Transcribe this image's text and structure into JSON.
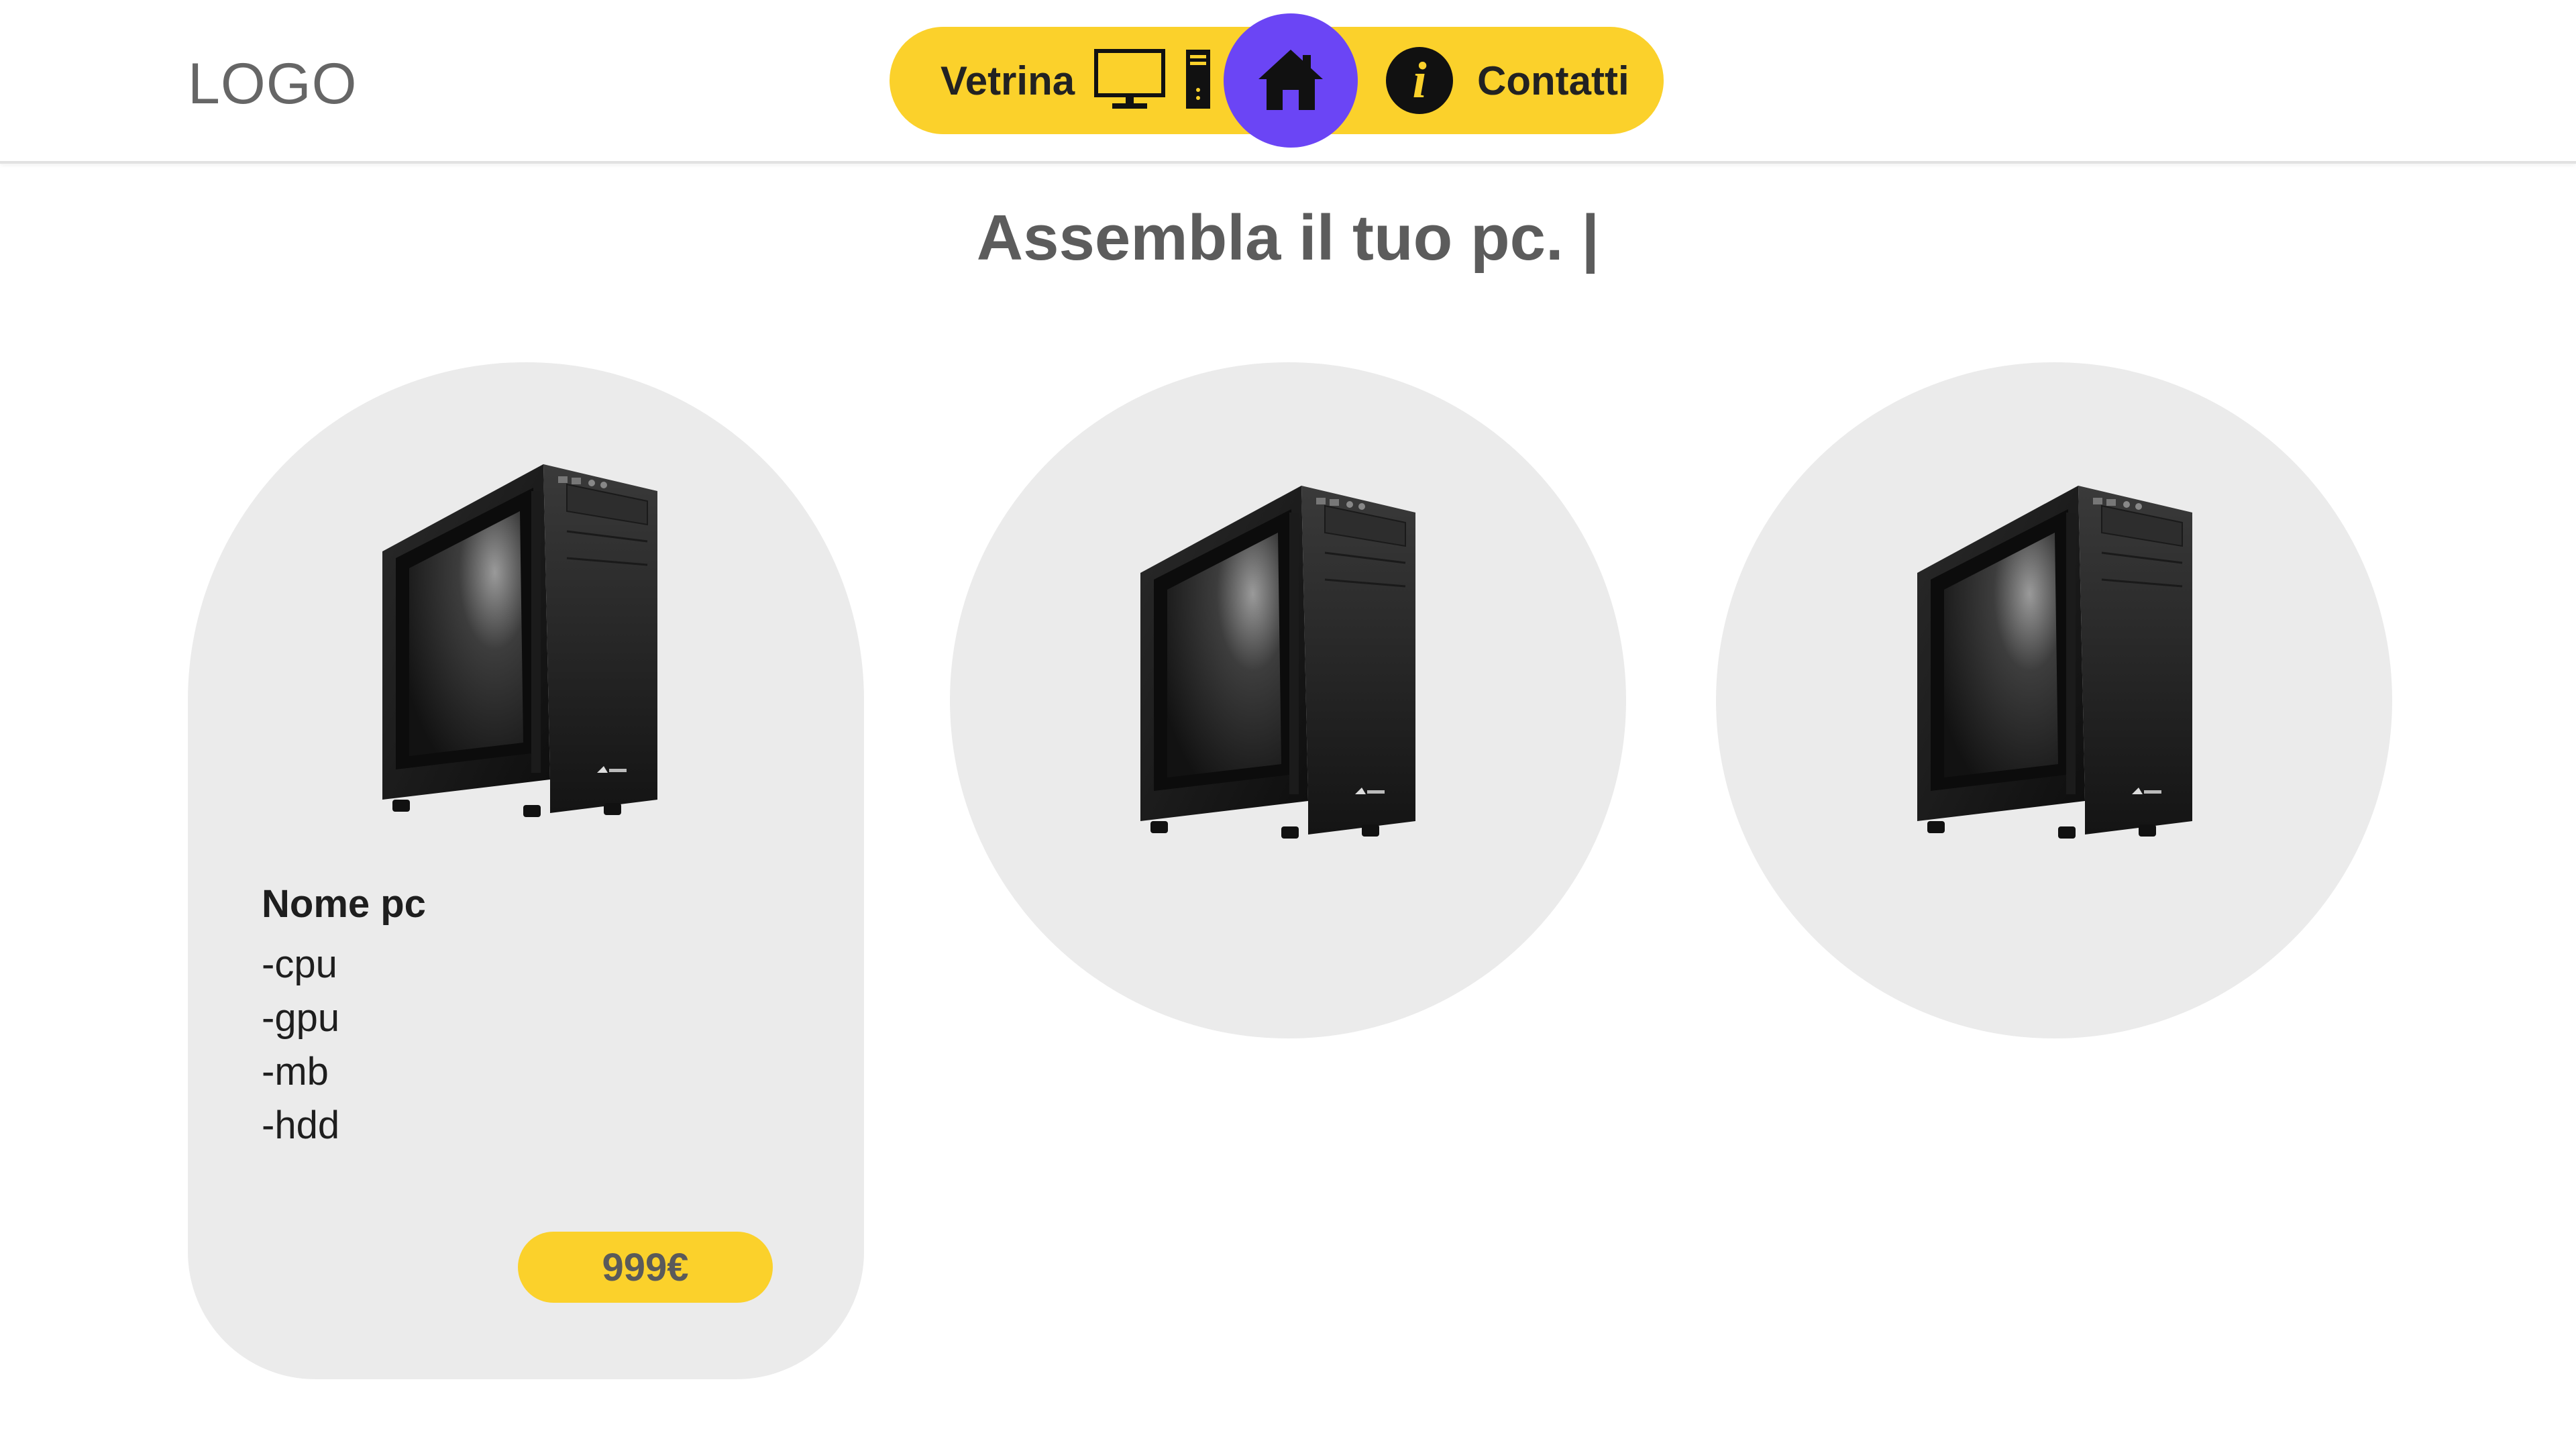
{
  "header": {
    "logo": "LOGO",
    "nav": {
      "vetrina_label": "Vetrina",
      "contatti_label": "Contatti"
    }
  },
  "main": {
    "headline": "Assembla il tuo pc. |",
    "cards": [
      {
        "name": "Nome pc",
        "specs": [
          "-cpu",
          "-gpu",
          "-mb",
          "-hdd"
        ],
        "price": "999€"
      }
    ]
  },
  "colors": {
    "accent_yellow": "#fbd12b",
    "home_purple": "#6b45f5",
    "card_bg": "#ebebeb"
  },
  "icons": [
    "monitor-icon",
    "pc-tower-icon",
    "home-icon",
    "info-icon"
  ]
}
